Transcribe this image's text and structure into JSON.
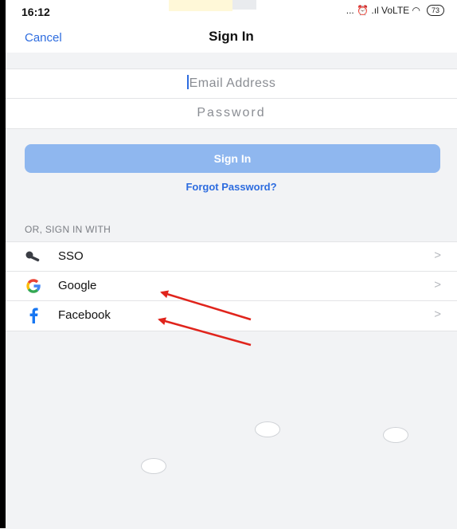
{
  "status_bar": {
    "time": "16:12",
    "indicators": "... ⏰ .ıl VoLTE ◠",
    "battery": "73"
  },
  "nav": {
    "cancel_label": "Cancel",
    "title": "Sign In"
  },
  "form": {
    "email_placeholder": "Email Address",
    "password_placeholder": "Password",
    "email_value": "",
    "password_value": ""
  },
  "actions": {
    "sign_in_label": "Sign In",
    "forgot_label": "Forgot Password?"
  },
  "alt_signin": {
    "section_label": "OR, SIGN IN WITH",
    "options": [
      {
        "label": "SSO",
        "icon": "key-icon"
      },
      {
        "label": "Google",
        "icon": "google-icon"
      },
      {
        "label": "Facebook",
        "icon": "facebook-icon"
      }
    ],
    "chevron": ">"
  },
  "colors": {
    "accent": "#2d6cdf",
    "button_disabled": "#8fb7ef",
    "background_gray": "#f2f3f5",
    "annotation_arrow": "#e0241c"
  }
}
